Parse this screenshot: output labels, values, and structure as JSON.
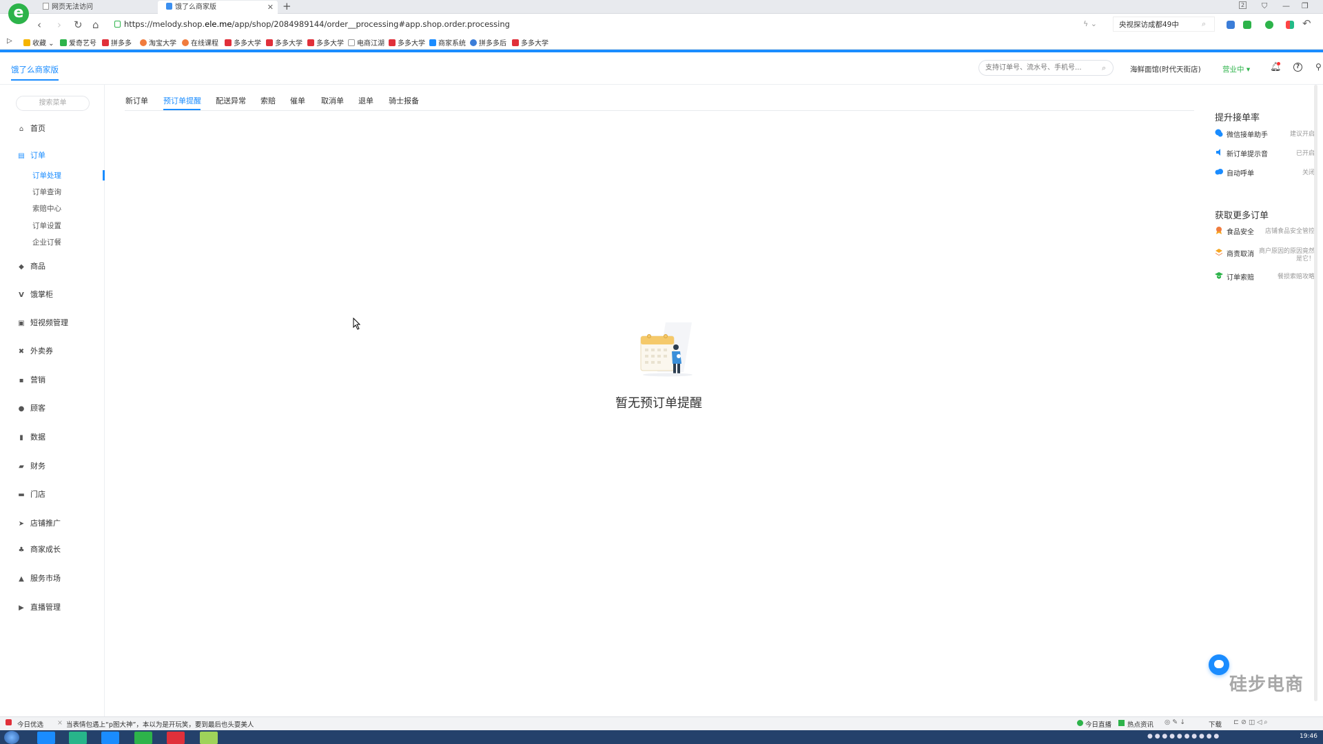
{
  "browser": {
    "tabs": [
      {
        "title": "网页无法访问"
      },
      {
        "title": "饿了么商家版"
      }
    ],
    "url_prefix": "https://melody.shop.",
    "url_domain": "ele.me",
    "url_suffix": "/app/shop/2084989144/order__processing#app.shop.order.processing",
    "news_search": "央视探访成都49中",
    "bookmarks": [
      "收藏",
      "爱奇艺号",
      "拼多多",
      "淘宝大学",
      "在线课程",
      "多多大学",
      "多多大学",
      "多多大学",
      "电商江湖",
      "多多大学",
      "商家系统",
      "拼多多后",
      "多多大学"
    ],
    "tab_count": "2"
  },
  "header": {
    "logo": "饿了么商家版",
    "search_placeholder": "支持订单号、流水号、手机号...",
    "shop_name": "海鲜面馆(时代天街店)",
    "status": "营业中"
  },
  "sidebar": {
    "search_placeholder": "搜索菜单",
    "items": [
      {
        "label": "首页",
        "icon": "home-icon"
      },
      {
        "label": "订单",
        "icon": "order-icon"
      },
      {
        "label": "商品",
        "icon": "goods-icon"
      },
      {
        "label": "饿掌柜",
        "icon": "v-icon"
      },
      {
        "label": "短视频管理",
        "icon": "video-icon"
      },
      {
        "label": "外卖券",
        "icon": "coupon-icon"
      },
      {
        "label": "营销",
        "icon": "marketing-icon"
      },
      {
        "label": "顾客",
        "icon": "customer-icon"
      },
      {
        "label": "数据",
        "icon": "chart-icon"
      },
      {
        "label": "财务",
        "icon": "finance-icon"
      },
      {
        "label": "门店",
        "icon": "store-icon"
      },
      {
        "label": "店铺推广",
        "icon": "send-icon"
      },
      {
        "label": "商家成长",
        "icon": "growth-icon"
      },
      {
        "label": "服务市场",
        "icon": "market-icon"
      },
      {
        "label": "直播管理",
        "icon": "live-icon"
      }
    ],
    "order_sub": [
      "订单处理",
      "订单查询",
      "索赔中心",
      "订单设置",
      "企业订餐"
    ]
  },
  "tabs": [
    "新订单",
    "预订单提醒",
    "配送异常",
    "索赔",
    "催单",
    "取消单",
    "退单",
    "骑士报备"
  ],
  "empty_state": {
    "text": "暂无预订单提醒"
  },
  "right_panel": {
    "section1_title": "提升接单率",
    "section1": [
      {
        "label": "微信接单助手",
        "value": "建议开启",
        "color": "#1a8cff"
      },
      {
        "label": "新订单提示音",
        "value": "已开启",
        "color": "#1a8cff"
      },
      {
        "label": "自动呼单",
        "value": "关闭",
        "color": "#1a8cff"
      }
    ],
    "section2_title": "获取更多订单",
    "section2": [
      {
        "label": "食品安全",
        "value": "店铺食品安全管控",
        "color": "#f07c3e"
      },
      {
        "label": "商责取消",
        "value": "商户原因的原因竟然是它！",
        "color": "#f5a623"
      },
      {
        "label": "订单索赔",
        "value": "餐损索赔攻略",
        "color": "#2db34a"
      }
    ]
  },
  "watermark": "硅步电商",
  "statusbar": {
    "left": "今日优选",
    "news": "当表情包遇上“p图大神”，本以为是开玩笑，要到最后也头耍美人",
    "right_items": [
      "今日直播",
      "热点资讯",
      "下载"
    ]
  },
  "clock": "19:46",
  "colors": {
    "accent": "#1a8cff",
    "success": "#2db34a"
  }
}
